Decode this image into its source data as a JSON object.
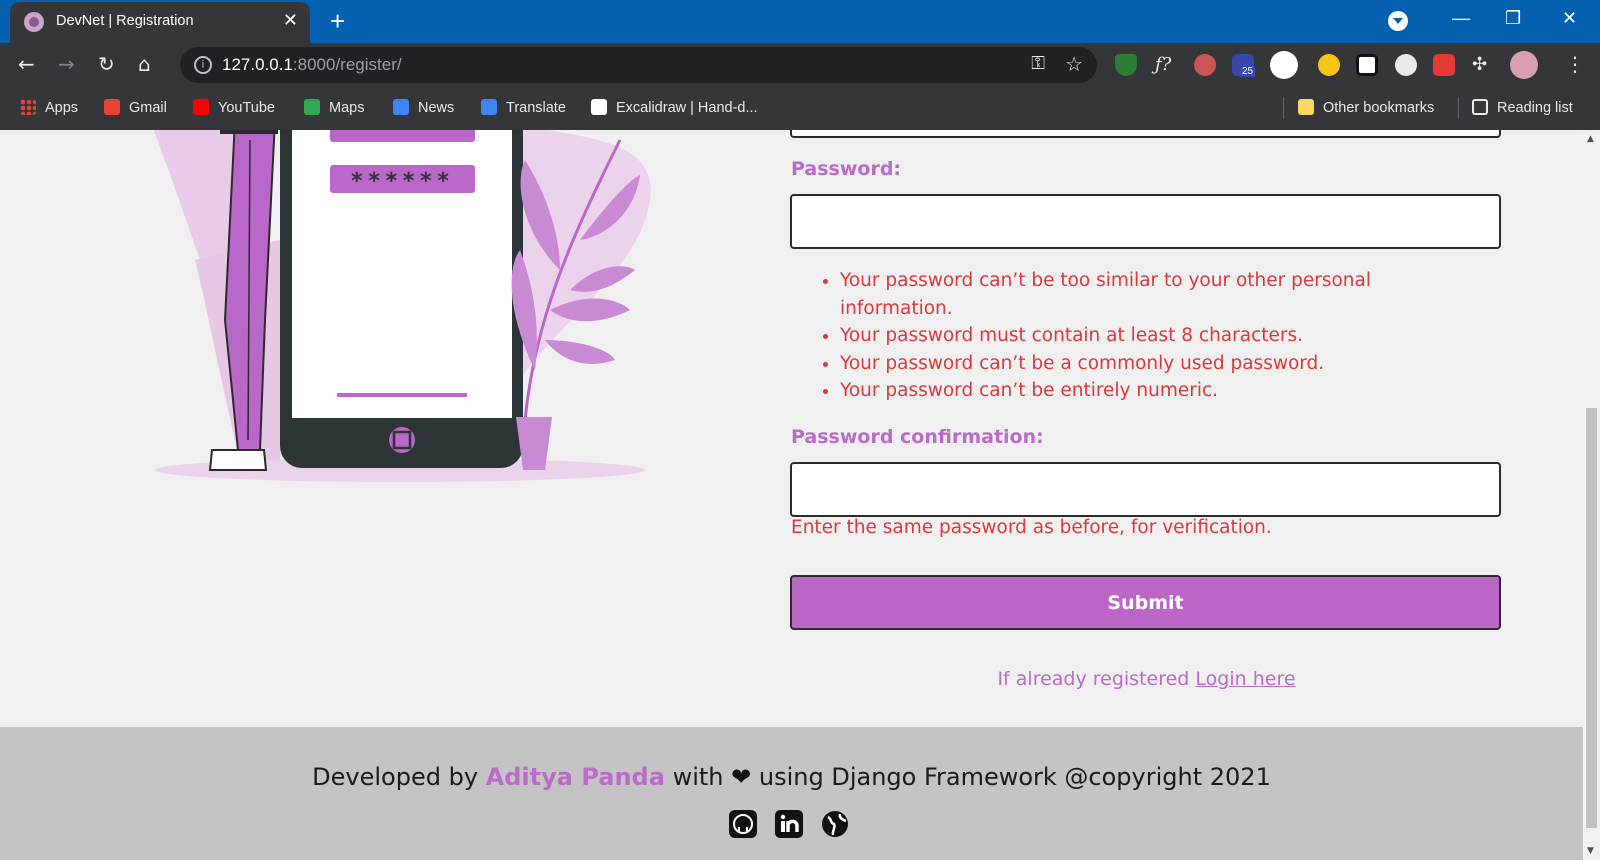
{
  "browser": {
    "tab_title": "DevNet | Registration",
    "tab_close": "✕",
    "new_tab": "+",
    "url_host": "127.0.0.1",
    "url_rest": ":8000/register/",
    "window_controls": [
      "—",
      "❐",
      "✕"
    ],
    "extension_badge": "25",
    "bookmarks": [
      {
        "label": "Apps",
        "icon": "apps-grid-icon",
        "color": "#ea4335"
      },
      {
        "label": "Gmail",
        "icon": "gmail-icon",
        "color": "#ea4335"
      },
      {
        "label": "YouTube",
        "icon": "youtube-icon",
        "color": "#ff0000"
      },
      {
        "label": "Maps",
        "icon": "maps-icon",
        "color": "#34a853"
      },
      {
        "label": "News",
        "icon": "news-icon",
        "color": "#4285f4"
      },
      {
        "label": "Translate",
        "icon": "translate-icon",
        "color": "#4285f4"
      },
      {
        "label": "Excalidraw | Hand-d...",
        "icon": "excalidraw-icon",
        "color": "#ffffff"
      }
    ],
    "other_bookmarks": "Other bookmarks",
    "reading_list": "Reading list"
  },
  "form": {
    "password_label": "Password:",
    "password_value": "",
    "password_help": [
      "Your password can’t be too similar to your other personal information.",
      "Your password must contain at least 8 characters.",
      "Your password can’t be a commonly used password.",
      "Your password can’t be entirely numeric."
    ],
    "confirm_label": "Password confirmation:",
    "confirm_value": "",
    "confirm_help": "Enter the same password as before, for verification.",
    "submit_label": "Submit",
    "login_prompt": "If already registered",
    "login_link": "Login here"
  },
  "illustration": {
    "password_mask": "******"
  },
  "footer": {
    "prefix": "Developed by",
    "author": "Aditya Panda",
    "with": "with",
    "heart": "❤",
    "suffix": "using Django Framework @copyright 2021",
    "social_icons": [
      "github-icon",
      "linkedin-icon",
      "globe-icon"
    ]
  },
  "colors": {
    "accent": "#bb66c7",
    "error": "#d9383d",
    "chrome_blue": "#0560b0",
    "footer_bg": "#c4c4c4"
  }
}
